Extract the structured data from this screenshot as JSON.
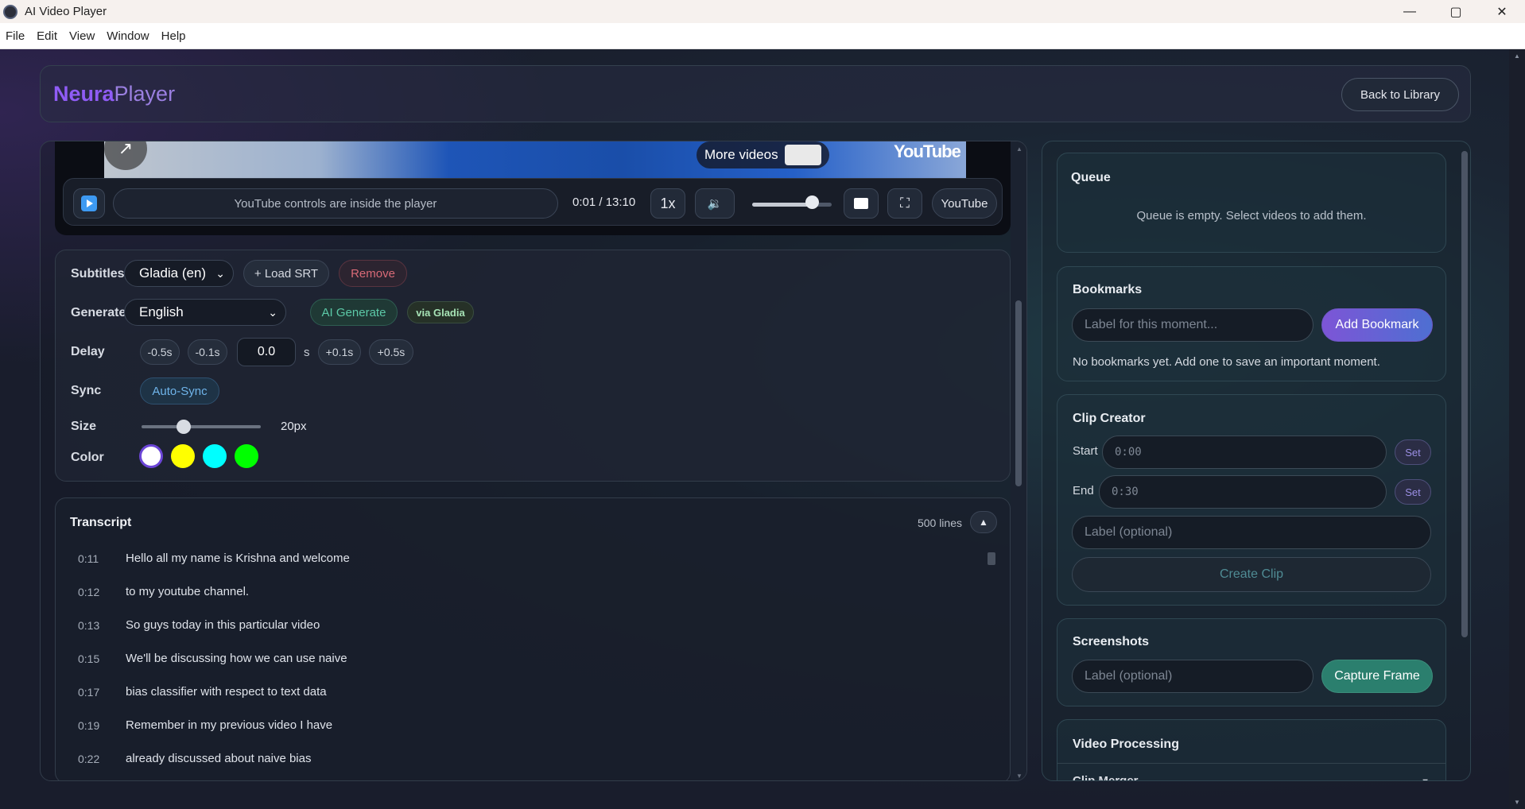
{
  "window": {
    "title": "AI Video Player",
    "minimize": "—",
    "maximize": "▢",
    "close": "✕"
  },
  "menu": [
    "File",
    "Edit",
    "View",
    "Window",
    "Help"
  ],
  "header": {
    "brand_part1": "Neura",
    "brand_part2": "Player",
    "back_button": "Back to Library"
  },
  "video": {
    "more_videos": "More videos",
    "youtube_logo": "YouTube"
  },
  "controls": {
    "message": "YouTube controls are inside the player",
    "time": "0:01 / 13:10",
    "speed": "1x",
    "volume_percent": 75,
    "youtube_button": "YouTube"
  },
  "subtitles": {
    "label": "Subtitles",
    "selected_track": "Gladia (en)",
    "load_srt": "+ Load SRT",
    "remove": "Remove",
    "generate_label": "Generate",
    "generate_language": "English",
    "ai_generate": "AI Generate",
    "via": "via Gladia",
    "delay_label": "Delay",
    "delay_minus_half": "-0.5s",
    "delay_minus_tenth": "-0.1s",
    "delay_value": "0.0",
    "delay_unit": "s",
    "delay_plus_tenth": "+0.1s",
    "delay_plus_half": "+0.5s",
    "sync_label": "Sync",
    "auto_sync": "Auto-Sync",
    "size_label": "Size",
    "size_value": "20px",
    "size_fraction": 0.35,
    "color_label": "Color",
    "colors": [
      "#ffffff",
      "#ffff00",
      "#00ffff",
      "#00ff00"
    ],
    "selected_color": "#ffffff"
  },
  "transcript": {
    "title": "Transcript",
    "count": "500 lines",
    "lines": [
      {
        "time": "0:11",
        "text": "Hello all my name is Krishna and welcome"
      },
      {
        "time": "0:12",
        "text": "to my youtube channel."
      },
      {
        "time": "0:13",
        "text": "So guys today in this particular video"
      },
      {
        "time": "0:15",
        "text": "We'll be discussing how we can use naive"
      },
      {
        "time": "0:17",
        "text": "bias classifier with respect to text data"
      },
      {
        "time": "0:19",
        "text": "Remember in my previous video I have"
      },
      {
        "time": "0:22",
        "text": "already discussed about naive bias"
      }
    ]
  },
  "queue": {
    "title": "Queue",
    "empty": "Queue is empty. Select videos to add them."
  },
  "bookmarks": {
    "title": "Bookmarks",
    "placeholder": "Label for this moment...",
    "add_button": "Add Bookmark",
    "empty": "No bookmarks yet. Add one to save an important moment."
  },
  "clip_creator": {
    "title": "Clip Creator",
    "start_label": "Start",
    "start_value": "0:00",
    "end_label": "End",
    "end_value": "0:30",
    "set_label": "Set",
    "label_placeholder": "Label (optional)",
    "create_button": "Create Clip"
  },
  "screenshots": {
    "title": "Screenshots",
    "placeholder": "Label (optional)",
    "capture_button": "Capture Frame"
  },
  "video_processing": {
    "title": "Video Processing",
    "clip_merger": "Clip Merger"
  }
}
